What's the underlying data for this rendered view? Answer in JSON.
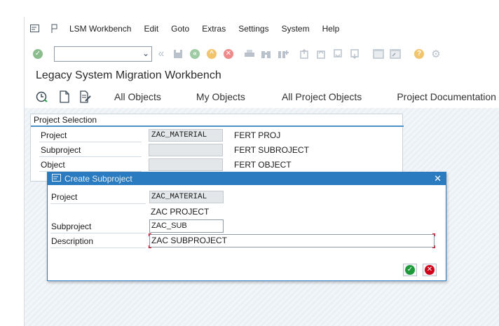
{
  "menu": {
    "items": [
      {
        "id": "lsm",
        "label": "LSM Workbench"
      },
      {
        "id": "edit",
        "label": "Edit"
      },
      {
        "id": "goto",
        "label": "Goto"
      },
      {
        "id": "extras",
        "label": "Extras"
      },
      {
        "id": "settings",
        "label": "Settings"
      },
      {
        "id": "system",
        "label": "System"
      },
      {
        "id": "help",
        "label": "Help"
      }
    ]
  },
  "toolbar": {
    "command_field_value": ""
  },
  "title": "Legacy System Migration Workbench",
  "app_toolbar": {
    "all_objects": "All Objects",
    "my_objects": "My Objects",
    "all_project_objects": "All Project Objects",
    "project_documentation": "Project Documentation"
  },
  "selection": {
    "title": "Project Selection",
    "rows": [
      {
        "label": "Project",
        "value": "ZAC_MATERIAL",
        "desc": "FERT PROJ"
      },
      {
        "label": "Subproject",
        "value": "",
        "desc": "FERT SUBROJECT"
      },
      {
        "label": "Object",
        "value": "",
        "desc": "FERT OBJECT"
      }
    ]
  },
  "dialog": {
    "title": "Create Subproject",
    "project_label": "Project",
    "project_value": "ZAC_MATERIAL",
    "project_desc": "ZAC PROJECT",
    "subproject_label": "Subproject",
    "subproject_value": "ZAC_SUB",
    "description_label": "Description",
    "description_value": "ZAC SUBPROJECT"
  },
  "colors": {
    "accent": "#2a7bc0",
    "ok": "#1f9a3b",
    "cancel": "#d0021b"
  }
}
